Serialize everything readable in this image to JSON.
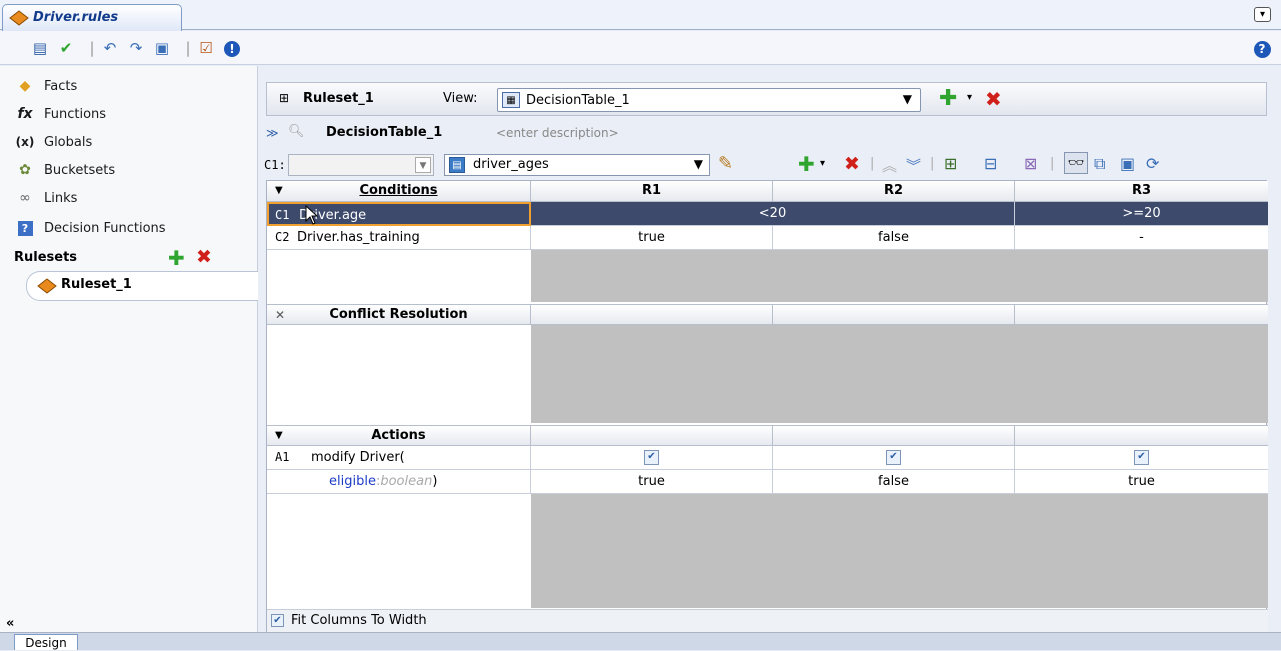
{
  "tab": {
    "title": "Driver.rules"
  },
  "toolbar": {
    "icons": [
      "book-icon",
      "check-icon",
      "undo-icon",
      "redo-icon",
      "save-icon",
      "validate-icon",
      "info-icon"
    ],
    "help_icon": "help-icon"
  },
  "left_panel": {
    "items": [
      {
        "label": "Facts",
        "icon": "facts-icon",
        "glyph": "◆"
      },
      {
        "label": "Functions",
        "icon": "function-icon",
        "glyph": "fx"
      },
      {
        "label": "Globals",
        "icon": "globals-icon",
        "glyph": "(x)"
      },
      {
        "label": "Bucketsets",
        "icon": "bucketsets-icon",
        "glyph": "✿"
      },
      {
        "label": "Links",
        "icon": "links-icon",
        "glyph": "∞"
      },
      {
        "label": "Decision Functions",
        "icon": "decision-functions-icon",
        "glyph": "?"
      }
    ],
    "rulesets_label": "Rulesets",
    "ruleset_item": "Ruleset_1",
    "collapse_glyph": "«"
  },
  "header": {
    "expand_glyph": "⊞",
    "ruleset_title": "Ruleset_1",
    "view_label": "View:",
    "view_value": "DecisionTable_1"
  },
  "decision_table": {
    "name": "DecisionTable_1",
    "description_placeholder": "<enter description>"
  },
  "controls": {
    "c1_label": "C1:",
    "c1_value": "",
    "bucketset_value": "driver_ages"
  },
  "conditions": {
    "header": "Conditions",
    "columns": [
      "R1",
      "R2",
      "R3"
    ],
    "rows": [
      {
        "id": "C1",
        "label": "Driver.age",
        "cells": [
          "<20",
          ">=20"
        ]
      },
      {
        "id": "C2",
        "label": "Driver.has_training",
        "cells": [
          "true",
          "false",
          "-"
        ]
      }
    ]
  },
  "conflict_resolution": {
    "header": "Conflict Resolution",
    "close_glyph": "✕"
  },
  "actions": {
    "header": "Actions",
    "a1_id": "A1",
    "a1_label": "modify Driver(",
    "param_name": "eligible",
    "param_sep": ":",
    "param_type": "boolean",
    "param_close": ")",
    "param_values": [
      "true",
      "false",
      "true"
    ]
  },
  "footer": {
    "fit_columns_label": "Fit Columns To Width",
    "fit_columns_checked": true
  },
  "bottom_tabs": {
    "design": "Design"
  },
  "colors": {
    "selected_row": "#3d4a6c",
    "accent_green": "#2fa52f",
    "accent_red": "#d0201a",
    "tab_text": "#123b8c"
  }
}
